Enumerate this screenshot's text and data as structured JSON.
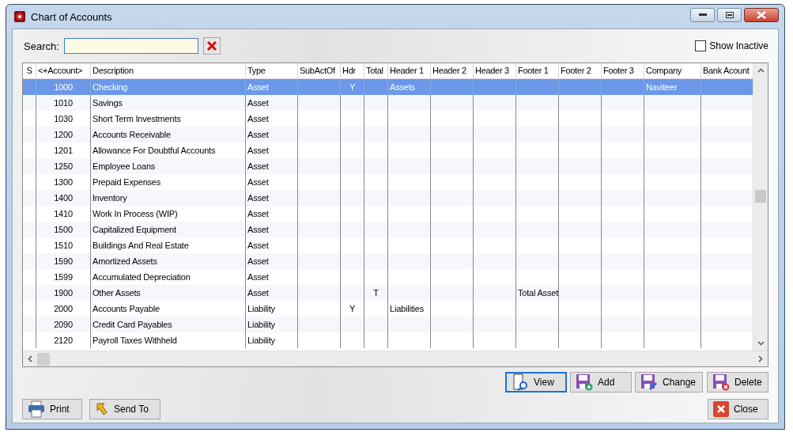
{
  "window": {
    "title": "Chart of Accounts"
  },
  "search": {
    "label": "Search:"
  },
  "show_inactive": {
    "label": "Show Inactive",
    "checked": false
  },
  "table": {
    "columns": [
      "S",
      "<+Account>",
      "Description",
      "Type",
      "SubActOf",
      "Hdr",
      "Total",
      "Header 1",
      "Header 2",
      "Header 3",
      "Footer 1",
      "Footer 2",
      "Footer 3",
      "Company",
      "Bank Acount"
    ],
    "rows": [
      {
        "selected": true,
        "cells": [
          null,
          "1000",
          "Checking",
          "Asset",
          null,
          "Y",
          null,
          "Assets",
          null,
          null,
          null,
          null,
          null,
          "Naviteer",
          null
        ]
      },
      {
        "selected": false,
        "cells": [
          null,
          "1010",
          "Savings",
          "Asset",
          null,
          null,
          null,
          null,
          null,
          null,
          null,
          null,
          null,
          null,
          null
        ]
      },
      {
        "selected": false,
        "cells": [
          null,
          "1030",
          "Short Term Investments",
          "Asset",
          null,
          null,
          null,
          null,
          null,
          null,
          null,
          null,
          null,
          null,
          null
        ]
      },
      {
        "selected": false,
        "cells": [
          null,
          "1200",
          "Accounts Receivable",
          "Asset",
          null,
          null,
          null,
          null,
          null,
          null,
          null,
          null,
          null,
          null,
          null
        ]
      },
      {
        "selected": false,
        "cells": [
          null,
          "1201",
          "Allowance For Doubtful Accounts",
          "Asset",
          null,
          null,
          null,
          null,
          null,
          null,
          null,
          null,
          null,
          null,
          null
        ]
      },
      {
        "selected": false,
        "cells": [
          null,
          "1250",
          "Employee Loans",
          "Asset",
          null,
          null,
          null,
          null,
          null,
          null,
          null,
          null,
          null,
          null,
          null
        ]
      },
      {
        "selected": false,
        "cells": [
          null,
          "1300",
          "Prepaid Expenses",
          "Asset",
          null,
          null,
          null,
          null,
          null,
          null,
          null,
          null,
          null,
          null,
          null
        ]
      },
      {
        "selected": false,
        "cells": [
          null,
          "1400",
          "Inventory",
          "Asset",
          null,
          null,
          null,
          null,
          null,
          null,
          null,
          null,
          null,
          null,
          null
        ]
      },
      {
        "selected": false,
        "cells": [
          null,
          "1410",
          "Work In Process (WIP)",
          "Asset",
          null,
          null,
          null,
          null,
          null,
          null,
          null,
          null,
          null,
          null,
          null
        ]
      },
      {
        "selected": false,
        "cells": [
          null,
          "1500",
          "Capitalized Equipment",
          "Asset",
          null,
          null,
          null,
          null,
          null,
          null,
          null,
          null,
          null,
          null,
          null
        ]
      },
      {
        "selected": false,
        "cells": [
          null,
          "1510",
          "Buildings And Real Estate",
          "Asset",
          null,
          null,
          null,
          null,
          null,
          null,
          null,
          null,
          null,
          null,
          null
        ]
      },
      {
        "selected": false,
        "cells": [
          null,
          "1590",
          "Amortized Assets",
          "Asset",
          null,
          null,
          null,
          null,
          null,
          null,
          null,
          null,
          null,
          null,
          null
        ]
      },
      {
        "selected": false,
        "cells": [
          null,
          "1599",
          "Accumulated Depreciation",
          "Asset",
          null,
          null,
          null,
          null,
          null,
          null,
          null,
          null,
          null,
          null,
          null
        ]
      },
      {
        "selected": false,
        "cells": [
          null,
          "1900",
          "Other Assets",
          "Asset",
          null,
          null,
          "T",
          null,
          null,
          null,
          "Total Asset",
          null,
          null,
          null,
          null
        ]
      },
      {
        "selected": false,
        "cells": [
          null,
          "2000",
          "Accounts Payable",
          "Liability",
          null,
          "Y",
          null,
          "Liabilities",
          null,
          null,
          null,
          null,
          null,
          null,
          null
        ]
      },
      {
        "selected": false,
        "cells": [
          null,
          "2090",
          "Credit Card Payables",
          "Liability",
          null,
          null,
          null,
          null,
          null,
          null,
          null,
          null,
          null,
          null,
          null
        ]
      },
      {
        "selected": false,
        "cells": [
          null,
          "2120",
          "Payroll Taxes Withheld",
          "Liability",
          null,
          null,
          null,
          null,
          null,
          null,
          null,
          null,
          null,
          null,
          null
        ]
      }
    ]
  },
  "actions": [
    {
      "label": "View",
      "kind": "view",
      "focused": true
    },
    {
      "label": "Add",
      "kind": "add",
      "focused": false
    },
    {
      "label": "Change",
      "kind": "change",
      "focused": false
    },
    {
      "label": "Delete",
      "kind": "delete",
      "focused": false
    }
  ],
  "footer_buttons": [
    {
      "label": "Print",
      "kind": "print"
    },
    {
      "label": "Send To",
      "kind": "send"
    }
  ],
  "close_button": {
    "label": "Close"
  }
}
